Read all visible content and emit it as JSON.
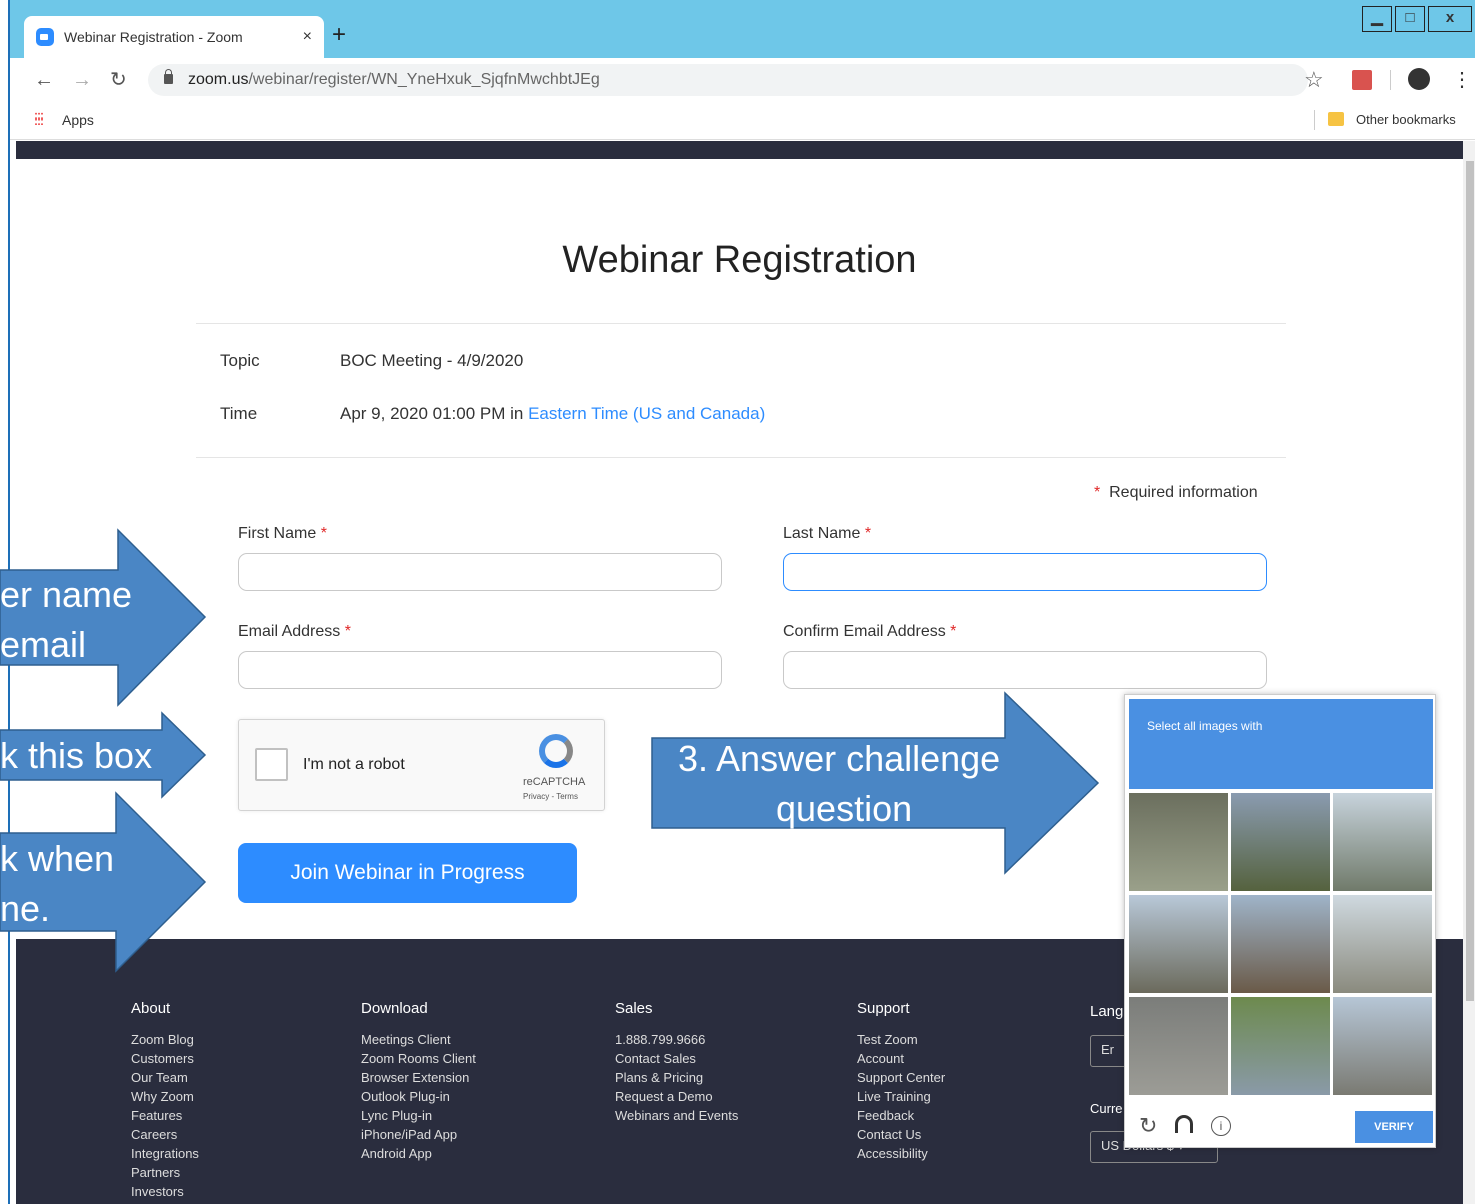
{
  "browser": {
    "tab_title": "Webinar Registration - Zoom",
    "tab_close": "×",
    "new_tab": "+",
    "window_controls": {
      "minimize": "▁",
      "maximize": "□",
      "close": "x"
    },
    "url_domain": "zoom.us",
    "url_path": "/webinar/register/WN_YneHxuk_SjqfnMwchbtJEg",
    "bookmarks": {
      "apps": "Apps",
      "other": "Other bookmarks"
    }
  },
  "page": {
    "title": "Webinar Registration",
    "topic_label": "Topic",
    "topic_value": "BOC Meeting - 4/9/2020",
    "time_label": "Time",
    "time_value": "Apr 9, 2020 01:00 PM in ",
    "time_zone": "Eastern Time (US and Canada)",
    "required_note": "Required information",
    "asterisk": "*"
  },
  "form": {
    "first_name": {
      "label": "First Name",
      "value": ""
    },
    "last_name": {
      "label": "Last Name",
      "value": ""
    },
    "email": {
      "label": "Email Address",
      "value": ""
    },
    "confirm_email": {
      "label": "Confirm Email Address",
      "value": ""
    },
    "captcha": {
      "label": "I'm not a robot",
      "brand": "reCAPTCHA",
      "links": "Privacy - Terms"
    },
    "submit_label": "Join Webinar in Progress"
  },
  "footer": {
    "columns": [
      {
        "heading": "About",
        "items": [
          "Zoom Blog",
          "Customers",
          "Our Team",
          "Why Zoom",
          "Features",
          "Careers",
          "Integrations",
          "Partners",
          "Investors"
        ]
      },
      {
        "heading": "Download",
        "items": [
          "Meetings Client",
          "Zoom Rooms Client",
          "Browser Extension",
          "Outlook Plug-in",
          "Lync Plug-in",
          "iPhone/iPad App",
          "Android App"
        ]
      },
      {
        "heading": "Sales",
        "items": [
          "1.888.799.9666",
          "Contact Sales",
          "Plans & Pricing",
          "Request a Demo",
          "Webinars and Events"
        ]
      },
      {
        "heading": "Support",
        "items": [
          "Test Zoom",
          "Account",
          "Support Center",
          "Live Training",
          "Feedback",
          "Contact Us",
          "Accessibility"
        ]
      }
    ],
    "language_label": "Lang",
    "language_value": "Er",
    "currency_label": "Curre",
    "currency_value": "US Dollars $ ▾"
  },
  "challenge": {
    "prompt": "Select all images with",
    "verify_label": "VERIFY"
  },
  "annotations": {
    "step1": [
      "er name",
      "email"
    ],
    "step2": "k this box",
    "step3": [
      "3. Answer challenge",
      "question"
    ],
    "step4": [
      "k when",
      "ne."
    ]
  }
}
